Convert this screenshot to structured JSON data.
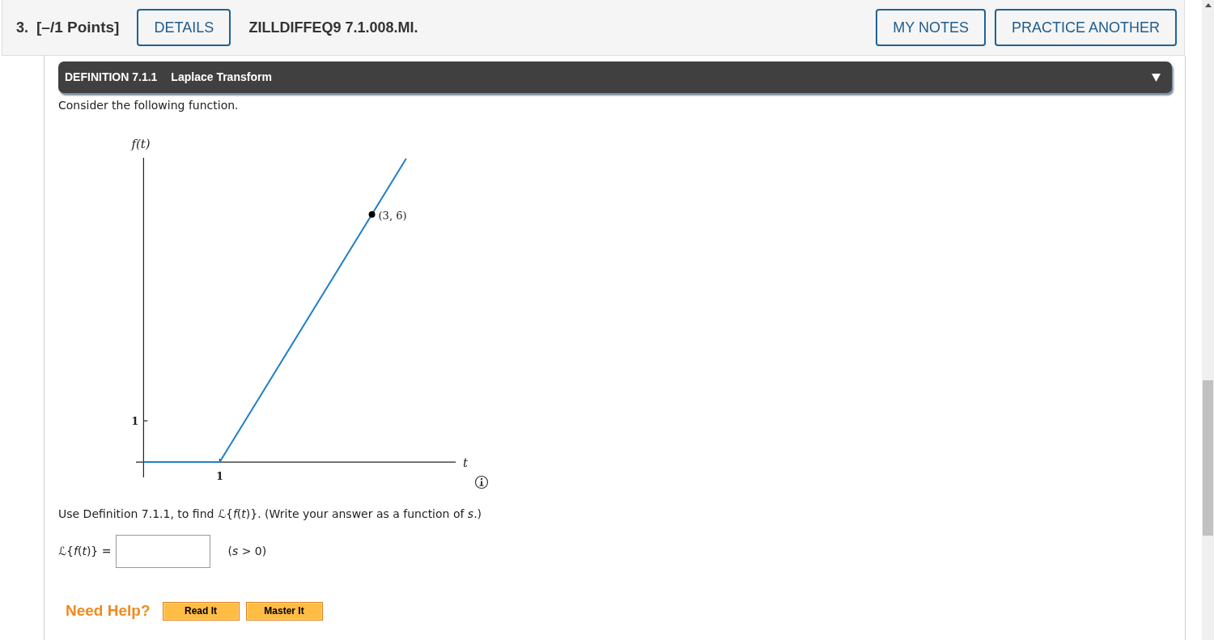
{
  "header": {
    "number": "3.",
    "points": "[–/1 Points]",
    "details_button": "DETAILS",
    "problem_id": "ZILLDIFFEQ9 7.1.008.MI.",
    "buttons": [
      "MY NOTES",
      "PRACTICE ANOTHER"
    ]
  },
  "definition": {
    "number": "DEFINITION 7.1.1",
    "title": "Laplace Transform"
  },
  "intro": "Consider the following function.",
  "graph": {
    "y_label": "f(t)",
    "x_label": "t",
    "y_tick": "1",
    "x_tick": "1",
    "point_label": "(3, 6)"
  },
  "question": "Use Definition 7.1.1, to find ℒ{*f*(*t*)}. (Write your answer as a function of *s*.)",
  "answer": {
    "label": "ℒ{*f*(*t*)} =",
    "condition": "(*s* > 0)"
  },
  "help": {
    "label": "Need Help?",
    "buttons": [
      "Read It",
      "Master It"
    ]
  }
}
